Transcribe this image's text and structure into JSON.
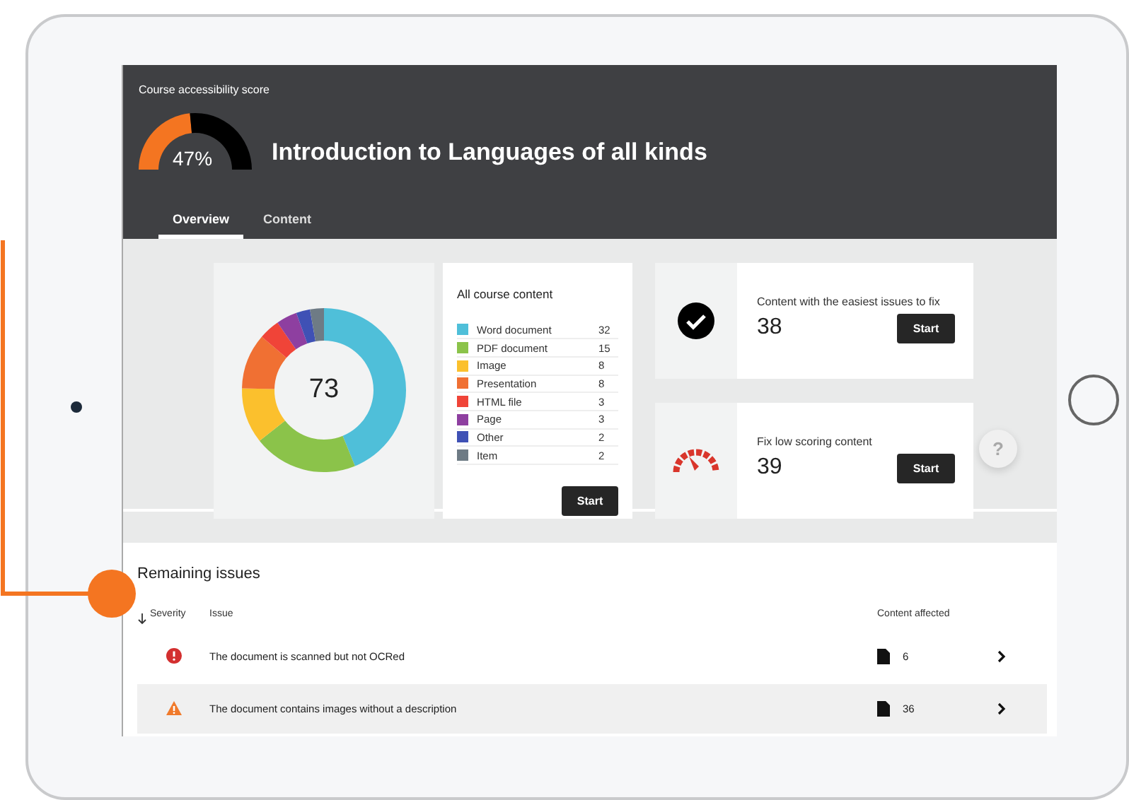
{
  "header": {
    "caption": "Course accessibility score",
    "score": {
      "level": 0.47,
      "label": "47%"
    },
    "title": "Introduction to Languages of all kinds",
    "tabs": [
      {
        "label": "Overview",
        "selected": true
      },
      {
        "label": "Content",
        "selected": false
      }
    ]
  },
  "content_card": {
    "total": "73",
    "title": "All course content",
    "chart_data": {
      "type": "donut",
      "values": [
        43.83,
        20.55,
        10.96,
        10.96,
        4.11,
        4.11,
        2.74,
        2.74
      ]
    },
    "legend": [
      {
        "name": "Word document",
        "count": "32",
        "color": "#4fbfd9"
      },
      {
        "name": "PDF document",
        "count": "15",
        "color": "#8bc34a"
      },
      {
        "name": "Image",
        "count": "8",
        "color": "#fbc02d"
      },
      {
        "name": "Presentation",
        "count": "8",
        "color": "#f07033"
      },
      {
        "name": "HTML file",
        "count": "3",
        "color": "#f04438"
      },
      {
        "name": "Page",
        "count": "3",
        "color": "#8e3fa0"
      },
      {
        "name": "Other",
        "count": "2",
        "color": "#3f51b5"
      },
      {
        "name": "Item",
        "count": "2",
        "color": "#6e7b85"
      }
    ],
    "button": "Start"
  },
  "task_cards": [
    {
      "kind": "easy",
      "title": "Content with the easiest issues to fix",
      "count": "38",
      "button": "Start"
    },
    {
      "kind": "low-score",
      "title": "Fix low scoring content",
      "count": "39",
      "button": "Start"
    }
  ],
  "help_button": "?",
  "issues": {
    "title": "Remaining issues",
    "columns": [
      "Severity",
      "Issue",
      "Content affected"
    ],
    "rows": [
      {
        "kind": "error",
        "issue": "The document is scanned but not OCRed",
        "count": "6",
        "highlighted": false
      },
      {
        "kind": "warning",
        "issue": "The document contains images without a description",
        "count": "36",
        "highlighted": true
      }
    ]
  }
}
